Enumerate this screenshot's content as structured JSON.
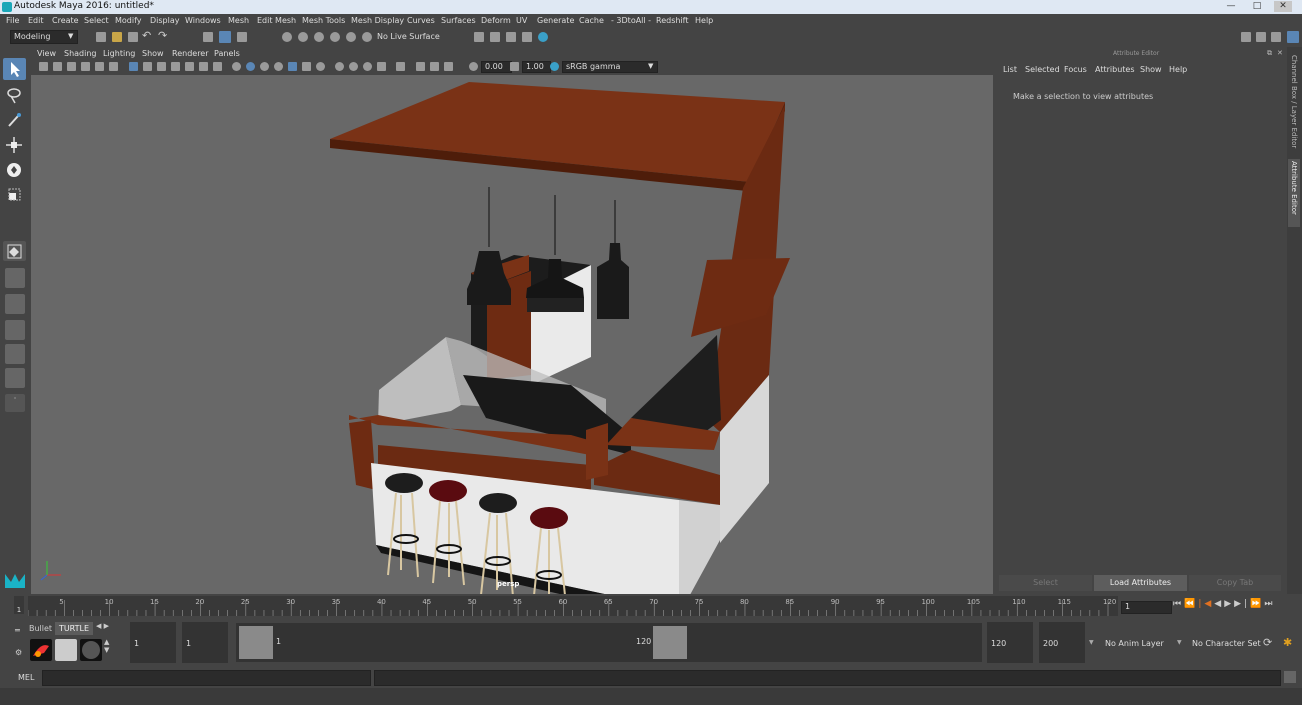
{
  "window": {
    "title": "Autodesk Maya 2016: untitled*",
    "controls": [
      "—",
      "□",
      "✕"
    ]
  },
  "menubar": [
    "File",
    "Edit",
    "Create",
    "Select",
    "Modify",
    "Display",
    "Windows",
    "Mesh",
    "Edit Mesh",
    "Mesh Tools",
    "Mesh Display",
    "Curves",
    "Surfaces",
    "Deform",
    "UV",
    "Generate",
    "Cache",
    "- 3DtoAll -",
    "Redshift",
    "Help"
  ],
  "statusline": {
    "mode": "Modeling",
    "live_surface": "No Live Surface"
  },
  "panel_menu": [
    "View",
    "Shading",
    "Lighting",
    "Show",
    "Renderer",
    "Panels"
  ],
  "panel_toolbar": {
    "exposure": "0.00",
    "gamma": "1.00",
    "color_space": "sRGB gamma"
  },
  "viewport": {
    "camera_label": "persp",
    "background": "#686868"
  },
  "attribute_editor": {
    "title": "Attribute Editor",
    "menu": [
      "List",
      "Selected",
      "Focus",
      "Attributes",
      "Show",
      "Help"
    ],
    "message": "Make a selection to view attributes",
    "buttons": {
      "select": "Select",
      "load": "Load Attributes",
      "copy_tab": "Copy Tab"
    }
  },
  "side_tabs": {
    "channel_box": "Channel Box / Layer Editor",
    "attribute_editor": "Attribute Editor"
  },
  "timeline": {
    "ticks": [
      "5",
      "10",
      "15",
      "20",
      "25",
      "30",
      "35",
      "40",
      "45",
      "50",
      "55",
      "60",
      "65",
      "70",
      "75",
      "80",
      "85",
      "90",
      "95",
      "100",
      "105",
      "110",
      "115",
      "120"
    ],
    "start_marker": "1",
    "current_frame": "1"
  },
  "range": {
    "shelf_tabs": [
      "Bullet",
      "TURTLE"
    ],
    "start": "1",
    "playback_start": "1",
    "slider_start": "1",
    "slider_end": "120",
    "playback_end": "120",
    "end": "200",
    "anim_layer": "No Anim Layer",
    "character_set": "No Character Set"
  },
  "cmdline": {
    "label": "MEL"
  },
  "colors": {
    "wood": "#6b2a12",
    "accent_blue": "#5a86b5",
    "stool_red": "#5a0b10",
    "stool_black": "#1d1d1d"
  }
}
